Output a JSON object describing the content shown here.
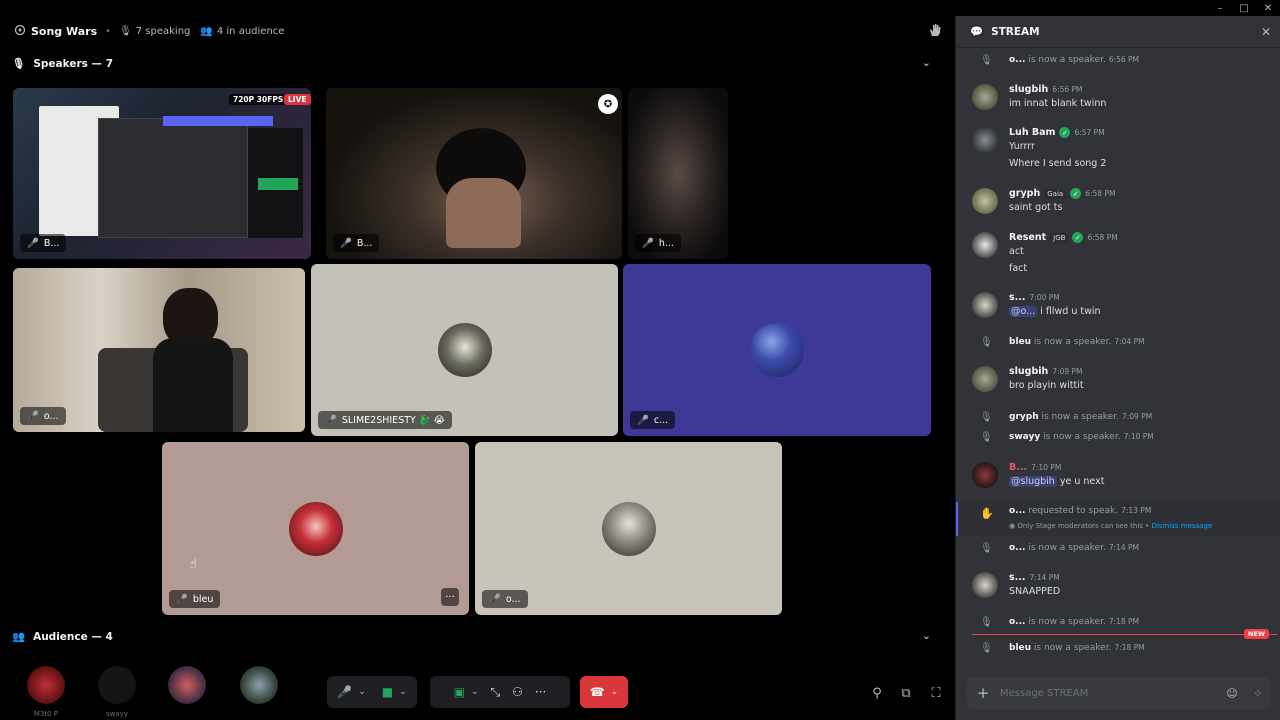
{
  "window": {
    "minimize": "–",
    "maximize": "□",
    "close": "✕"
  },
  "topbar": {
    "title": "Song Wars",
    "speaking": "7 speaking",
    "audience": "4 in audience"
  },
  "speakers_header": "Speakers — 7",
  "audience_header": "Audience — 4",
  "tiles": {
    "t1": {
      "name": "B...",
      "badge_res": "720P 30FPS",
      "badge_live": "LIVE"
    },
    "t2": {
      "name": "B..."
    },
    "t3": {
      "name": "h..."
    },
    "t4": {
      "name": "o..."
    },
    "t5": {
      "name": "SLIME2SHIESTY 🐉 😭"
    },
    "t6": {
      "name": "c..."
    },
    "t7": {
      "name": "bleu"
    },
    "t8": {
      "name": "o..."
    }
  },
  "audience": [
    "M3t0 P",
    "swayy",
    "",
    ""
  ],
  "colors": {
    "stage_bg": "#000000",
    "chat_bg": "#313338",
    "accent": "#5865f2",
    "danger": "#da373c",
    "online": "#23a55a"
  },
  "chat": {
    "title": "STREAM",
    "messages": [
      {
        "kind": "sys",
        "user": "o...",
        "text": "is now a speaker.",
        "time": "6:56 PM"
      },
      {
        "kind": "msg",
        "user": "slugbih",
        "time": "6:56 PM",
        "lines": [
          "im innat blank twinn"
        ]
      },
      {
        "kind": "msg",
        "user": "Luh Bam",
        "time": "6:57 PM",
        "lines": [
          "Yurrrr",
          "Where I send song  2"
        ]
      },
      {
        "kind": "msg",
        "user": "gryph",
        "tag": "Gaia",
        "time": "6:58 PM",
        "lines": [
          "saint got ts"
        ]
      },
      {
        "kind": "msg",
        "user": "Resent",
        "tag": "JGB",
        "time": "6:58 PM",
        "lines": [
          "act",
          "fact"
        ]
      },
      {
        "kind": "msg",
        "user": "s...",
        "time": "7:00 PM",
        "mention": "@o...",
        "lines": [
          "i fllwd u twin"
        ]
      },
      {
        "kind": "sys",
        "user": "bleu",
        "text": "is now a speaker.",
        "time": "7:04 PM"
      },
      {
        "kind": "msg",
        "user": "slugbih",
        "time": "7:09 PM",
        "lines": [
          "bro playin wittit"
        ]
      },
      {
        "kind": "sys",
        "user": "gryph",
        "text": "is now a speaker.",
        "time": "7:09 PM"
      },
      {
        "kind": "sys",
        "user": "swayy",
        "text": "is now a speaker.",
        "time": "7:10 PM"
      },
      {
        "kind": "msg",
        "user": "B...",
        "time": "7:10 PM",
        "mention": "@slugbih",
        "lines": [
          "ye u next"
        ]
      },
      {
        "kind": "req",
        "user": "o...",
        "text": "requested to speak.",
        "time": "7:13 PM",
        "note": "Only Stage moderators can see this •",
        "dismiss": "Dismiss message"
      },
      {
        "kind": "sys",
        "user": "o...",
        "text": "is now a speaker.",
        "time": "7:14 PM"
      },
      {
        "kind": "msg",
        "user": "s...",
        "time": "7:14 PM",
        "lines": [
          "SNAAPPED"
        ]
      },
      {
        "kind": "sys",
        "user": "o...",
        "text": "is now a speaker.",
        "time": "7:18 PM"
      },
      {
        "kind": "sys",
        "user": "bleu",
        "text": "is now a speaker.",
        "time": "7:18 PM"
      }
    ],
    "new_label": "NEW",
    "composer_placeholder": "Message STREAM"
  }
}
